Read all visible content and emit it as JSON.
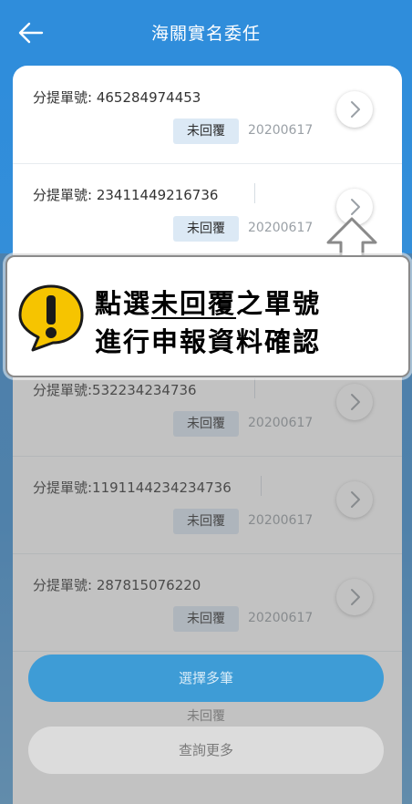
{
  "header": {
    "title": "海關實名委任"
  },
  "bill_label": "分提單號",
  "status_label": "未回覆",
  "items": [
    {
      "bill": "分提單號: 465284974453",
      "status": "未回覆",
      "date": "20200617"
    },
    {
      "bill": "分提單號: 23411449216736",
      "status": "未回覆",
      "date": "20200617"
    },
    {
      "bill": "分提單號:532234234736",
      "status": "未回覆",
      "date": "20200617"
    },
    {
      "bill": "分提單號:1191144234234736",
      "status": "未回覆",
      "date": "20200617"
    },
    {
      "bill": "分提單號: 287815076220",
      "status": "未回覆",
      "date": "20200617"
    }
  ],
  "partial_item": {
    "status": "未回覆"
  },
  "buttons": {
    "select_multiple": "選擇多筆",
    "load_more": "查詢更多"
  },
  "callout": {
    "line1_prefix": "點選",
    "line1_highlight": "未回覆",
    "line1_suffix": "之單號",
    "line2": "進行申報資料確認"
  },
  "colors": {
    "header_blue": "#2f8ddb",
    "badge_bg": "#dce9f5",
    "callout_warning": "#f6c400"
  },
  "icons": {
    "back": "arrow-left-icon",
    "chevron": "chevron-right-icon",
    "warning": "exclamation-warning-icon",
    "pointer": "up-arrow-icon"
  }
}
